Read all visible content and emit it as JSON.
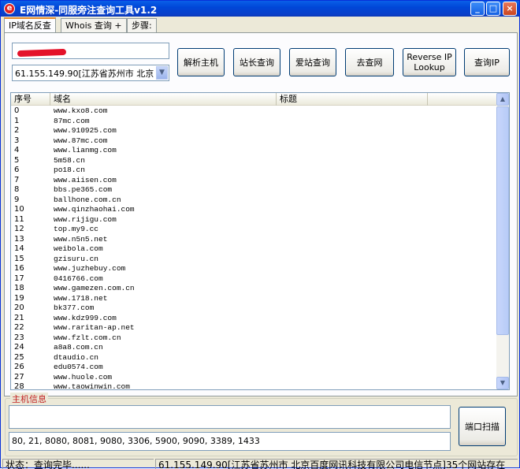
{
  "window": {
    "title": "E网情深-同服旁注查询工具v1.2",
    "minimize": "_",
    "maximize": "□",
    "close": "×"
  },
  "tabs": [
    "IP域名反查",
    "Whois 查询 +",
    "步骤:"
  ],
  "domain_input": {
    "value": ""
  },
  "ip_select": {
    "value": "61.155.149.90[江苏省苏州市 北京"
  },
  "buttons": {
    "resolve": "解析主机",
    "webmaster": "站长查询",
    "aizhan": "爱站查询",
    "quwang": "去查网",
    "reverse_line1": "Reverse IP",
    "reverse_line2": "Lookup",
    "query_ip": "查询IP",
    "port_scan": "端口扫描"
  },
  "table": {
    "columns": [
      "序号",
      "域名",
      "标题"
    ],
    "rows": [
      [
        "0",
        "www.kxo8.com"
      ],
      [
        "1",
        "87mc.com"
      ],
      [
        "2",
        "www.910925.com"
      ],
      [
        "3",
        "www.87mc.com"
      ],
      [
        "4",
        "www.lianmg.com"
      ],
      [
        "5",
        "5m58.cn"
      ],
      [
        "6",
        "po18.cn"
      ],
      [
        "7",
        "www.aiisen.com"
      ],
      [
        "8",
        "bbs.pe365.com"
      ],
      [
        "9",
        "ballhone.com.cn"
      ],
      [
        "10",
        "www.qinzhaohai.com"
      ],
      [
        "11",
        "www.rijigu.com"
      ],
      [
        "12",
        "top.my9.cc"
      ],
      [
        "13",
        "www.n5n5.net"
      ],
      [
        "14",
        "weibola.com"
      ],
      [
        "15",
        "gzisuru.cn"
      ],
      [
        "16",
        "www.juzhebuy.com"
      ],
      [
        "17",
        "0416766.com"
      ],
      [
        "18",
        "www.gamezen.com.cn"
      ],
      [
        "19",
        "www.1718.net"
      ],
      [
        "20",
        "bk377.com"
      ],
      [
        "21",
        "www.kdz999.com"
      ],
      [
        "22",
        "www.raritan-ap.net"
      ],
      [
        "23",
        "www.fzlt.com.cn"
      ],
      [
        "24",
        "a8a8.com.cn"
      ],
      [
        "25",
        "dtaudio.cn"
      ],
      [
        "26",
        "edu0574.com"
      ],
      [
        "27",
        "www.huole.com"
      ],
      [
        "28",
        "www.taowinwin.com"
      ]
    ]
  },
  "host_info": {
    "label": "主机信息",
    "info_value": "",
    "ports_value": "80, 21, 8080, 8081, 9080, 3306, 5900, 9090, 3389, 1433"
  },
  "status": {
    "left": "状态：查询完毕......",
    "right": "61.155.149.90[江苏省苏州市 北京百度网讯科技有限公司电信节点]35个网站存在"
  },
  "colors": {
    "titlebar": "#0a4fd8",
    "window_bg": "#ece9d8",
    "group_label": "#c02020"
  }
}
